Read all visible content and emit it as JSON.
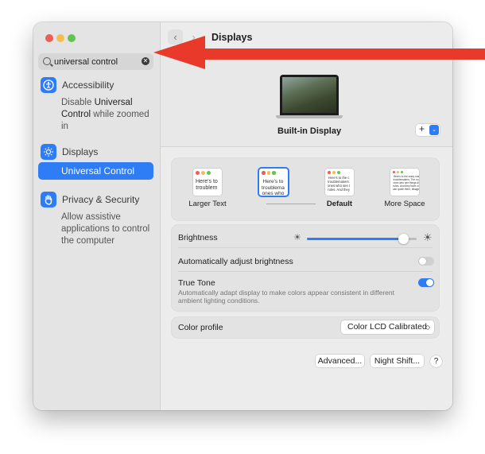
{
  "window": {
    "title": "Displays"
  },
  "search": {
    "value": "universal control"
  },
  "results": [
    {
      "label": "Accessibility",
      "desc_pre": "Disable ",
      "desc_bold": "Universal Control",
      "desc_post": " while zoomed in",
      "icon": "accessibility-icon",
      "color": "#2e7cf6"
    },
    {
      "label": "Displays",
      "icon": "sun-icon",
      "color": "#2e7cf6",
      "selected_label": "Universal Control"
    },
    {
      "label": "Privacy & Security",
      "desc": "Allow assistive applications to control the computer",
      "icon": "hand-icon",
      "color": "#2e7cf6"
    }
  ],
  "display": {
    "name": "Built-in Display",
    "add_label": "+",
    "add_chevron": "⌄"
  },
  "resolution_options": [
    {
      "label": "Larger Text",
      "thumb_text": "Here's to\ntroublem",
      "font": 7
    },
    {
      "label": "",
      "thumb_text": "Here's to\ntroublema\nones who",
      "font": 6.5
    },
    {
      "label": "Default",
      "thumb_text": "Here's to the c\ntroublemakers.\nones who see t\nrules. And they",
      "font": 4.2
    },
    {
      "label": "More Space",
      "thumb_text": "Here's to the crazy one\ntroublemakers. The rou\nones who see things dif\nrules. And they have no\ncan quote them, disagre",
      "font": 3.2
    }
  ],
  "brightness": {
    "label": "Brightness",
    "value": 0.88
  },
  "auto_brightness": {
    "label": "Automatically adjust brightness",
    "on": false
  },
  "true_tone": {
    "label": "True Tone",
    "desc": "Automatically adapt display to make colors appear consistent in different ambient lighting conditions.",
    "on": true
  },
  "color_profile": {
    "label": "Color profile",
    "value": "Color LCD Calibrated",
    "chevron": "◇"
  },
  "buttons": {
    "advanced": "Advanced...",
    "night_shift": "Night Shift...",
    "help": "?"
  },
  "colors": {
    "accent": "#2e7cf6",
    "arrow": "#e8392a"
  }
}
